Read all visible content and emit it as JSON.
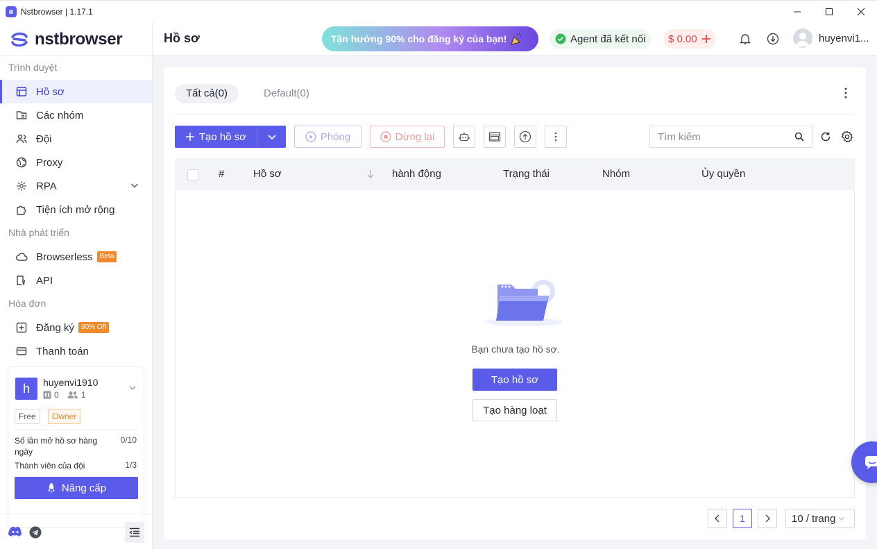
{
  "window": {
    "title": "Nstbrowser | 1.17.1"
  },
  "brand": {
    "logo_text": "nstbrowser",
    "accent": "#5b5bea"
  },
  "sidebar": {
    "sections": {
      "browser": "Trình duyệt",
      "developer": "Nhà phát triển",
      "billing": "Hóa đơn"
    },
    "items": [
      {
        "label": "Hồ sơ",
        "icon": "profile-icon",
        "active": true
      },
      {
        "label": "Các nhóm",
        "icon": "groups-icon"
      },
      {
        "label": "Đội",
        "icon": "team-icon"
      },
      {
        "label": "Proxy",
        "icon": "globe-icon"
      },
      {
        "label": "RPA",
        "icon": "rpa-icon"
      },
      {
        "label": "Tiện ích mở rộng",
        "icon": "puzzle-icon"
      },
      {
        "label": "Browserless",
        "icon": "cloud-icon",
        "badge": "Beta"
      },
      {
        "label": "API",
        "icon": "api-icon"
      },
      {
        "label": "Đăng ký",
        "icon": "subscribe-icon",
        "badge": "90% Off"
      },
      {
        "label": "Thanh toán",
        "icon": "card-icon"
      }
    ],
    "user_card": {
      "avatar_letter": "h",
      "username": "huyenvi1910",
      "profiles_count": "0",
      "members_count": "1",
      "plan_tag": "Free",
      "role_tag": "Owner",
      "daily_opens_label": "Số lần mở hồ sơ hàng ngày",
      "daily_opens_value": "0/10",
      "team_members_label": "Thành viên của đội",
      "team_members_value": "1/3",
      "upgrade_label": "Nâng cấp"
    }
  },
  "header": {
    "page_title": "Hồ sơ",
    "promo_text": "Tận hưởng 90% cho đăng ký của bạn!",
    "agent_status": "Agent đã kết nối",
    "balance": "$ 0.00",
    "username": "huyenvi1..."
  },
  "main": {
    "tabs": [
      {
        "label": "Tất cả(0)",
        "active": true
      },
      {
        "label": "Default(0)"
      }
    ],
    "toolbar": {
      "create_label": "Tạo hồ sơ",
      "launch_label": "Phóng",
      "stop_label": "Dừng lại",
      "search_placeholder": "Tìm kiếm"
    },
    "table": {
      "columns": [
        "#",
        "Hồ sơ",
        "hành động",
        "Trạng thái",
        "Nhóm",
        "Ủy quyền"
      ]
    },
    "empty": {
      "message": "Bạn chưa tạo hồ sơ.",
      "create_label": "Tạo hồ sơ",
      "bulk_label": "Tạo hàng loạt"
    },
    "pagination": {
      "current_page": "1",
      "page_size": "10 / trang"
    }
  }
}
